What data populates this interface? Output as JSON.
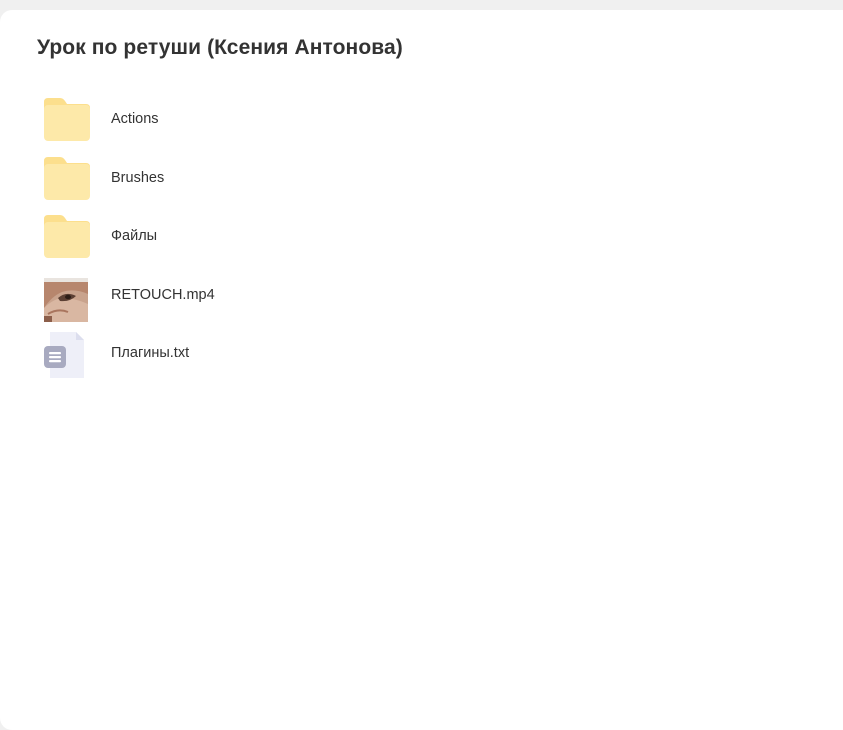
{
  "header": {
    "title": "Урок по ретуши (Ксения Антонова)"
  },
  "items": [
    {
      "name": "Actions",
      "icon": "folder-icon"
    },
    {
      "name": "Brushes",
      "icon": "folder-icon"
    },
    {
      "name": "Файлы",
      "icon": "folder-icon"
    },
    {
      "name": "RETOUCH.mp4",
      "icon": "video-thumbnail"
    },
    {
      "name": "Плагины.txt",
      "icon": "text-file-icon"
    }
  ],
  "colors": {
    "folder_body": "#fde9a9",
    "folder_tab": "#fcdf8d",
    "text_file_sheet": "#eeeff8",
    "text_file_badge": "#a8aac0",
    "text": "#333333"
  }
}
